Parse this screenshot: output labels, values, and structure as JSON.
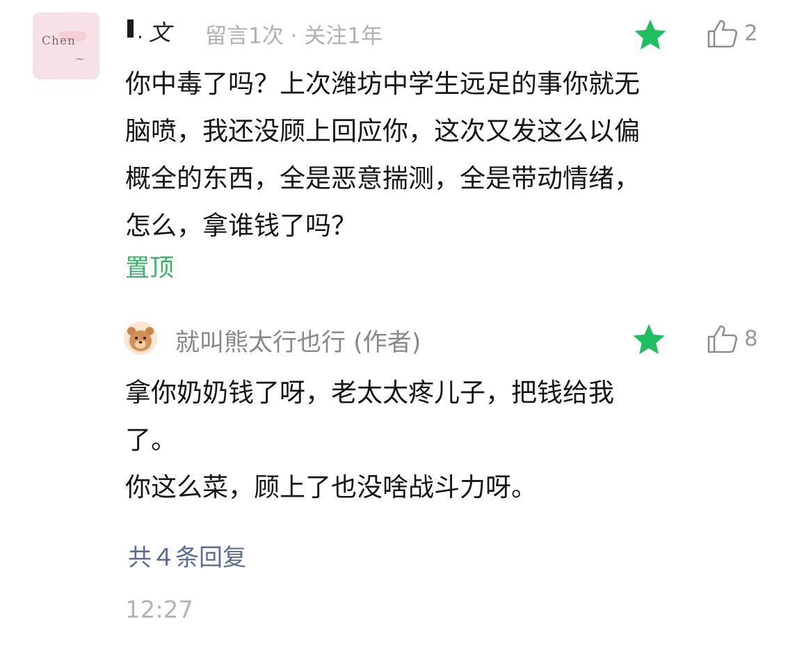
{
  "main_comment": {
    "username": "文",
    "meta": "留言1次 · 关注1年",
    "avatar_text": "Chen",
    "like_count": "2",
    "content": "你中毒了吗？上次潍坊中学生远足的事你就无\n脑喷，我还没顾上回应你，这次又发这么以偏\n概全的东西，全是恶意揣测，全是带动情绪，\n怎么，拿谁钱了吗？",
    "pin_label": "置顶"
  },
  "reply": {
    "author": "就叫熊太行也行 (作者)",
    "like_count": "8",
    "content": "拿你奶奶钱了呀，老太太疼儿子，把钱给我\n了。\n你这么菜，顾上了也没啥战斗力呀。"
  },
  "footer": {
    "replies_link": "共４条回复",
    "timestamp": "12:27"
  },
  "colors": {
    "star": "#1fbf62",
    "pin": "#3bb46a",
    "link": "#586d95"
  }
}
